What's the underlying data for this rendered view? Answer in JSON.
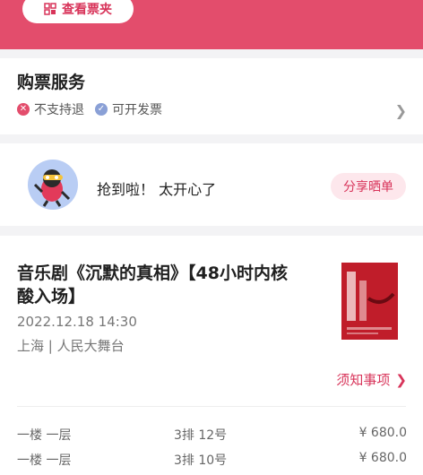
{
  "header": {
    "ticket_button": "查看票夹",
    "icon": "ticket-wallet-icon"
  },
  "service": {
    "title": "购票服务",
    "items": [
      {
        "label": "不支持退",
        "icon": "close-circle-icon",
        "color": "#e34d6c"
      },
      {
        "label": "可开发票",
        "icon": "check-circle-icon",
        "color": "#8aa0d6"
      }
    ]
  },
  "share": {
    "text": "抢到啦！ 太开心了",
    "button": "分享晒单"
  },
  "order": {
    "title": "音乐剧《沉默的真相》【48小时内核酸入场】",
    "datetime": "2022.12.18 14:30",
    "venue": "上海 | 人民大舞台",
    "notice_link": "须知事项"
  },
  "seats": [
    {
      "floor": "一楼 一层",
      "seat": "3排 12号",
      "price": "¥ 680.0"
    },
    {
      "floor": "一楼 一层",
      "seat": "3排 10号",
      "price": "¥ 680.0"
    }
  ],
  "colors": {
    "accent": "#e34d6c",
    "accent_text": "#d8345a",
    "share_bg": "#fde7ec"
  }
}
